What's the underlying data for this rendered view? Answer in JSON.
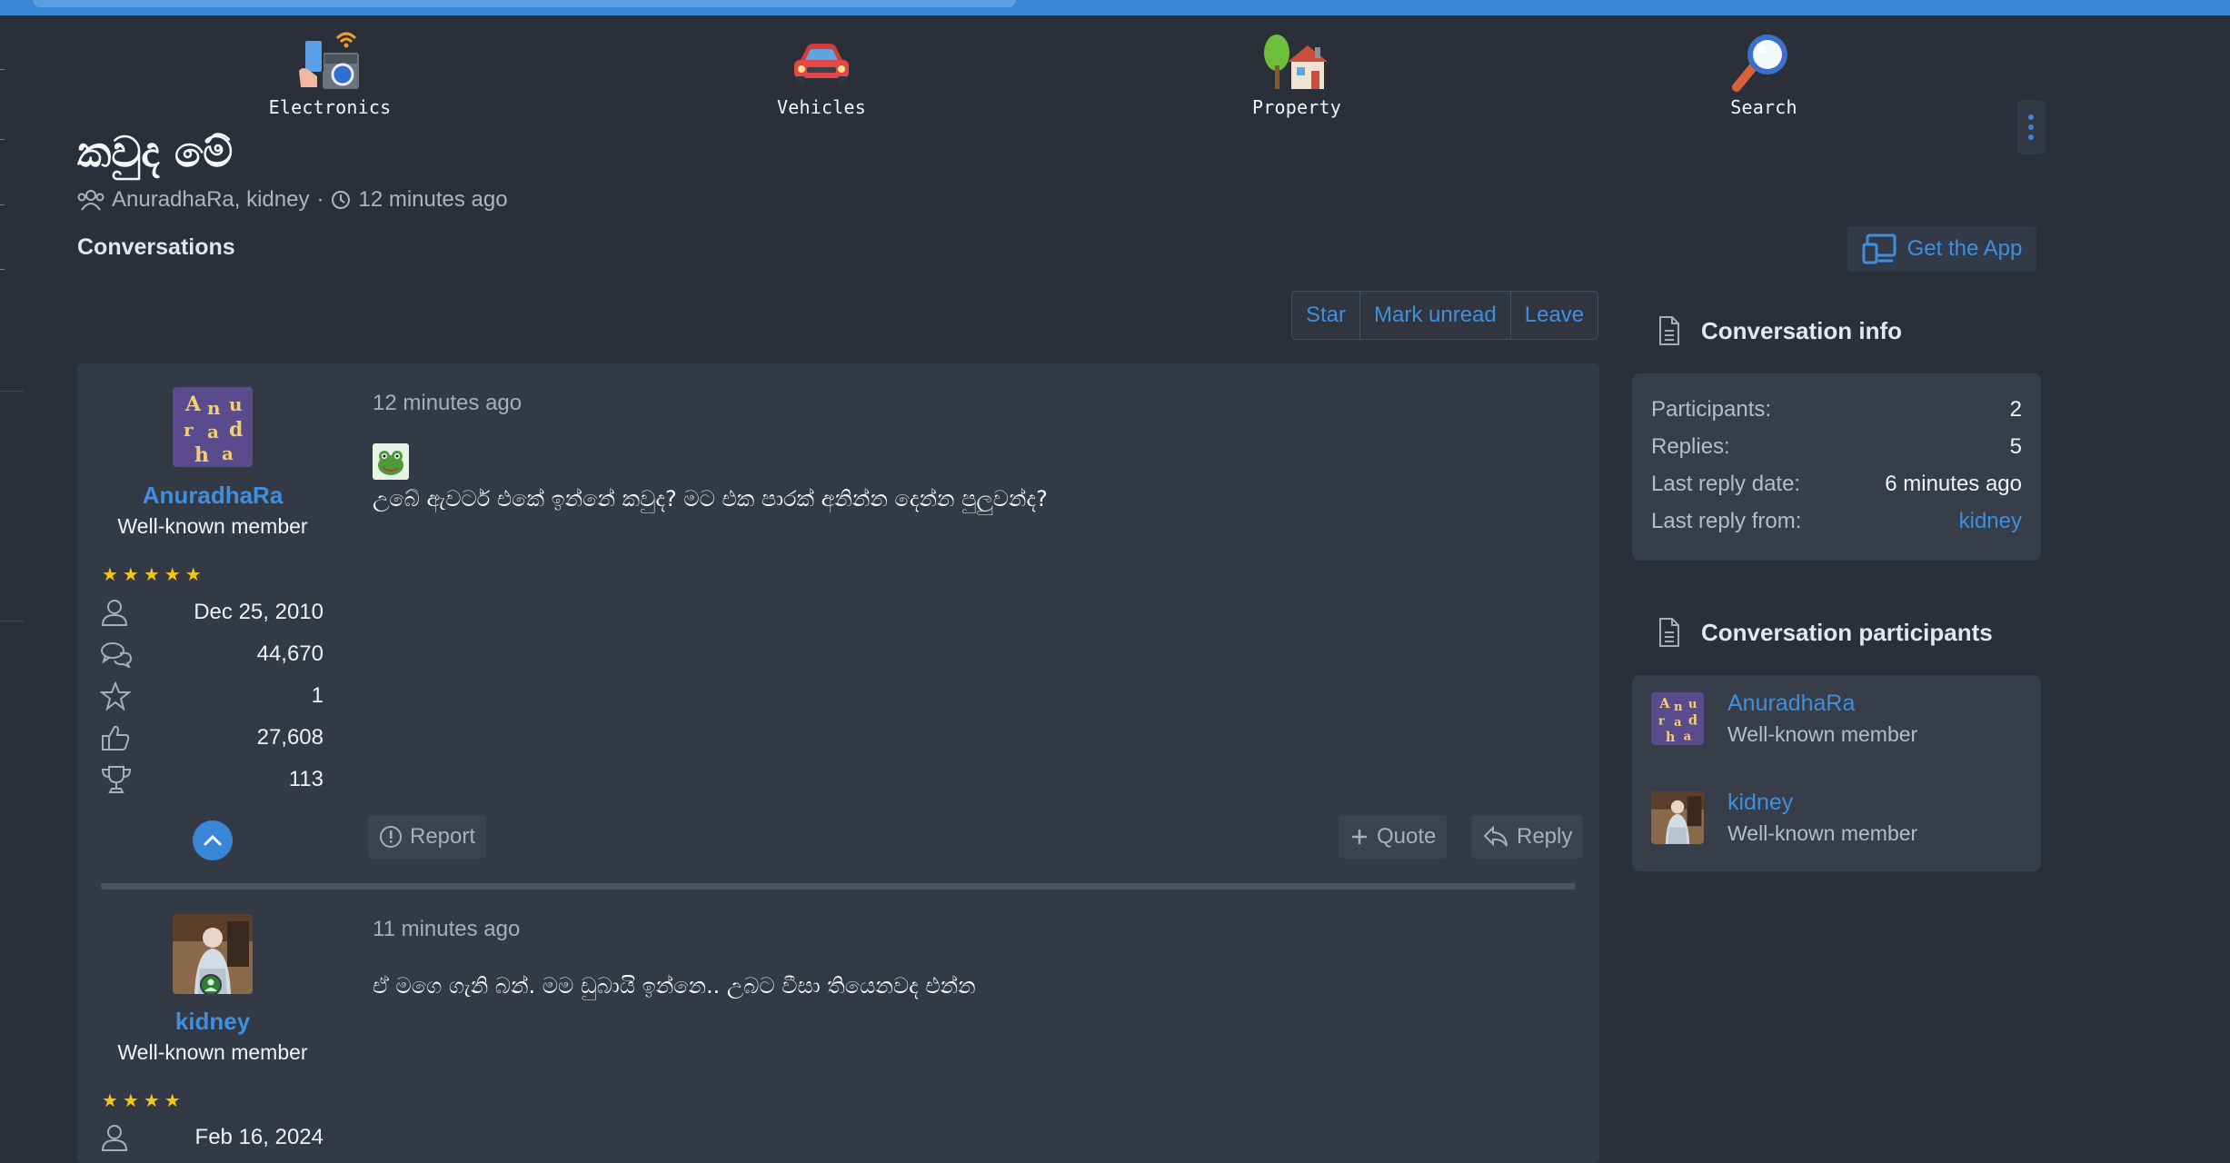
{
  "nav": {
    "categories": [
      {
        "label": "Electronics",
        "icon": "electronics-icon"
      },
      {
        "label": "Vehicles",
        "icon": "car-icon"
      },
      {
        "label": "Property",
        "icon": "house-icon"
      },
      {
        "label": "Search",
        "icon": "magnifier-icon"
      }
    ]
  },
  "thread": {
    "title": "කවුද මේ",
    "participants_text": "AnuradhaRa, kidney",
    "separator": "·",
    "time": "12 minutes ago",
    "breadcrumb": "Conversations"
  },
  "get_app": {
    "label": "Get the App"
  },
  "actions": {
    "star": "Star",
    "mark_unread": "Mark unread",
    "leave": "Leave"
  },
  "messages": [
    {
      "author": "AnuradhaRa",
      "title": "Well-known member",
      "stars": "★★★★★",
      "stats": {
        "joined": "Dec 25, 2010",
        "messages": "44,670",
        "reaction_score": "1",
        "likes": "27,608",
        "points": "113"
      },
      "time": "12 minutes ago",
      "text": "උබේ ඇවටර් එකේ ඉන්නේ කවුද? මට එක පාරක් අනින්න දෙන්න පුලුවන්ද?",
      "buttons": {
        "report": "Report",
        "quote": "Quote",
        "reply": "Reply"
      }
    },
    {
      "author": "kidney",
      "title": "Well-known member",
      "stars": "★★★★",
      "stats": {
        "joined": "Feb 16, 2024"
      },
      "time": "11 minutes ago",
      "text": "ඒ මගෙ ගැනි බන්. මම ඩුබායි ඉන්නෙ.. උබට වීසා තියෙනවද එන්න"
    }
  ],
  "sidebar": {
    "info": {
      "heading": "Conversation info",
      "rows": [
        {
          "label": "Participants:",
          "value": "2"
        },
        {
          "label": "Replies:",
          "value": "5"
        },
        {
          "label": "Last reply date:",
          "value": "6 minutes ago"
        },
        {
          "label": "Last reply from:",
          "value": "kidney"
        }
      ]
    },
    "participants": {
      "heading": "Conversation participants",
      "list": [
        {
          "name": "AnuradhaRa",
          "title": "Well-known member"
        },
        {
          "name": "kidney",
          "title": "Well-known member"
        }
      ]
    }
  },
  "colors": {
    "accent": "#3a86d6",
    "link": "#3f8fdf",
    "background": "#2b2f3a",
    "panel": "#343946",
    "star": "#f5c518"
  }
}
